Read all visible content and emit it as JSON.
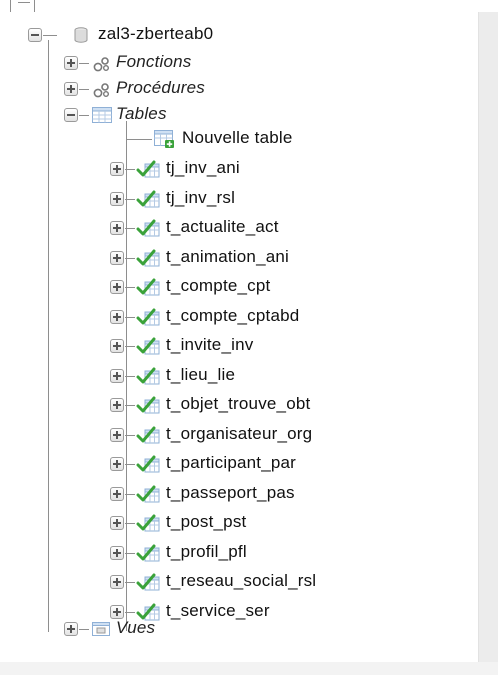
{
  "database": {
    "name": "zal3-zberteab0"
  },
  "groups": {
    "functions": "Fonctions",
    "procedures": "Procédures",
    "tables": "Tables",
    "views": "Vues"
  },
  "new_table_label": "Nouvelle table",
  "tables": [
    "tj_inv_ani",
    "tj_inv_rsl",
    "t_actualite_act",
    "t_animation_ani",
    "t_compte_cpt",
    "t_compte_cptabd",
    "t_invite_inv",
    "t_lieu_lie",
    "t_objet_trouve_obt",
    "t_organisateur_org",
    "t_participant_par",
    "t_passeport_pas",
    "t_post_pst",
    "t_profil_pfl",
    "t_reseau_social_rsl",
    "t_service_ser"
  ],
  "icons": {
    "database": "database-icon",
    "functions": "functions-icon",
    "procedures": "procedures-icon",
    "tables": "tables-group-icon",
    "new_table": "new-table-icon",
    "table": "table-icon",
    "views": "views-icon"
  },
  "colors": {
    "tree_line": "#8e8e8e",
    "table_icon_green": "#3aa23a",
    "table_icon_blue": "#6f9fd6"
  }
}
